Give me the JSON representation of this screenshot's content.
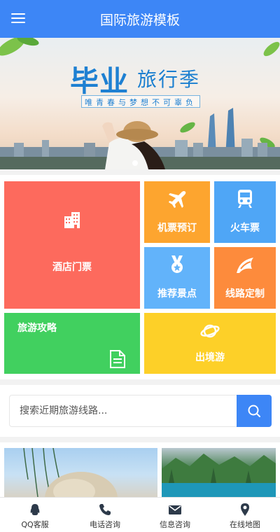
{
  "header": {
    "title": "国际旅游模板",
    "menu_icon": "hamburger-menu-icon"
  },
  "banner": {
    "title_main": "毕业",
    "title_secondary": "旅行季",
    "subtitle": "唯青春与梦想不可辜负",
    "slide_count": 1,
    "active_slide": 1
  },
  "tiles": [
    {
      "label": "酒店门票",
      "icon": "building-icon",
      "color": "#fd6a5d"
    },
    {
      "label": "机票预订",
      "icon": "airplane-icon",
      "color": "#fda52f"
    },
    {
      "label": "火车票",
      "icon": "train-icon",
      "color": "#4fa6f6"
    },
    {
      "label": "推荐景点",
      "icon": "medal-icon",
      "color": "#62b3fa"
    },
    {
      "label": "线路定制",
      "icon": "flag-icon",
      "color": "#fd8b3c"
    },
    {
      "label": "旅游攻略",
      "icon": "document-icon",
      "color": "#41d05f"
    },
    {
      "label": "出境游",
      "icon": "planet-icon",
      "color": "#fdd028"
    }
  ],
  "search": {
    "placeholder": "搜索近期旅游线路...",
    "icon": "search-icon"
  },
  "tabbar": {
    "items": [
      {
        "label": "QQ客服",
        "icon": "qq-icon"
      },
      {
        "label": "电话咨询",
        "icon": "phone-icon"
      },
      {
        "label": "信息咨询",
        "icon": "mail-icon"
      },
      {
        "label": "在线地图",
        "icon": "map-pin-icon"
      }
    ]
  },
  "colors": {
    "accent": "#3d86f6"
  }
}
